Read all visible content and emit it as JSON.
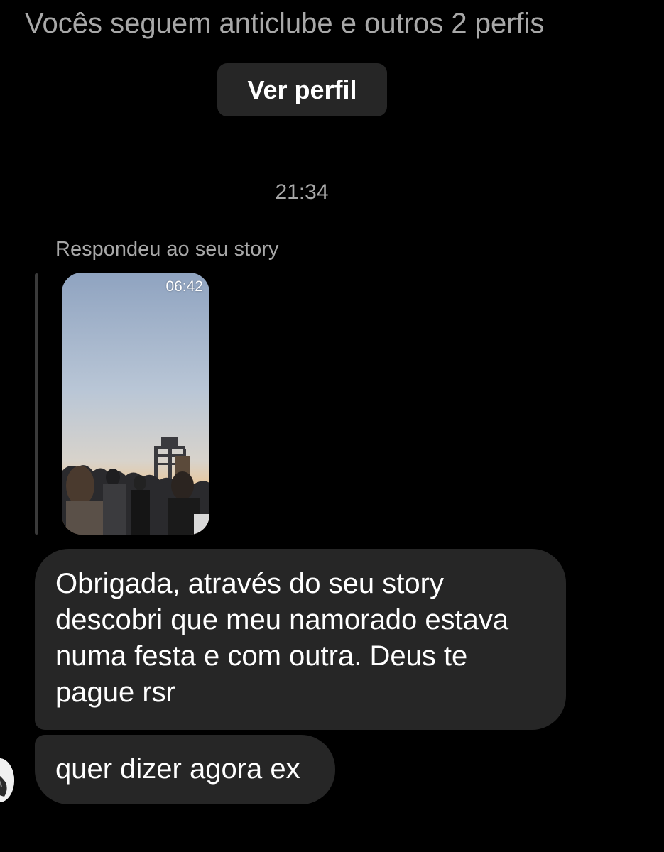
{
  "header": {
    "mutual_followers": "Vocês seguem anticlube e outros 2 perfis",
    "view_profile_label": "Ver perfil"
  },
  "thread": {
    "timestamp": "21:34",
    "story_reply": {
      "caption": "Respondeu ao seu story",
      "story_time": "06:42"
    },
    "messages": [
      {
        "text": "Obrigada, através do seu story descobri que meu namorado estava numa festa e com outra. Deus te pague rsr"
      },
      {
        "text": "quer dizer agora ex"
      }
    ]
  },
  "colors": {
    "background": "#000000",
    "bubble": "#262626",
    "muted_text": "#a8a8a8",
    "button": "#262626"
  }
}
